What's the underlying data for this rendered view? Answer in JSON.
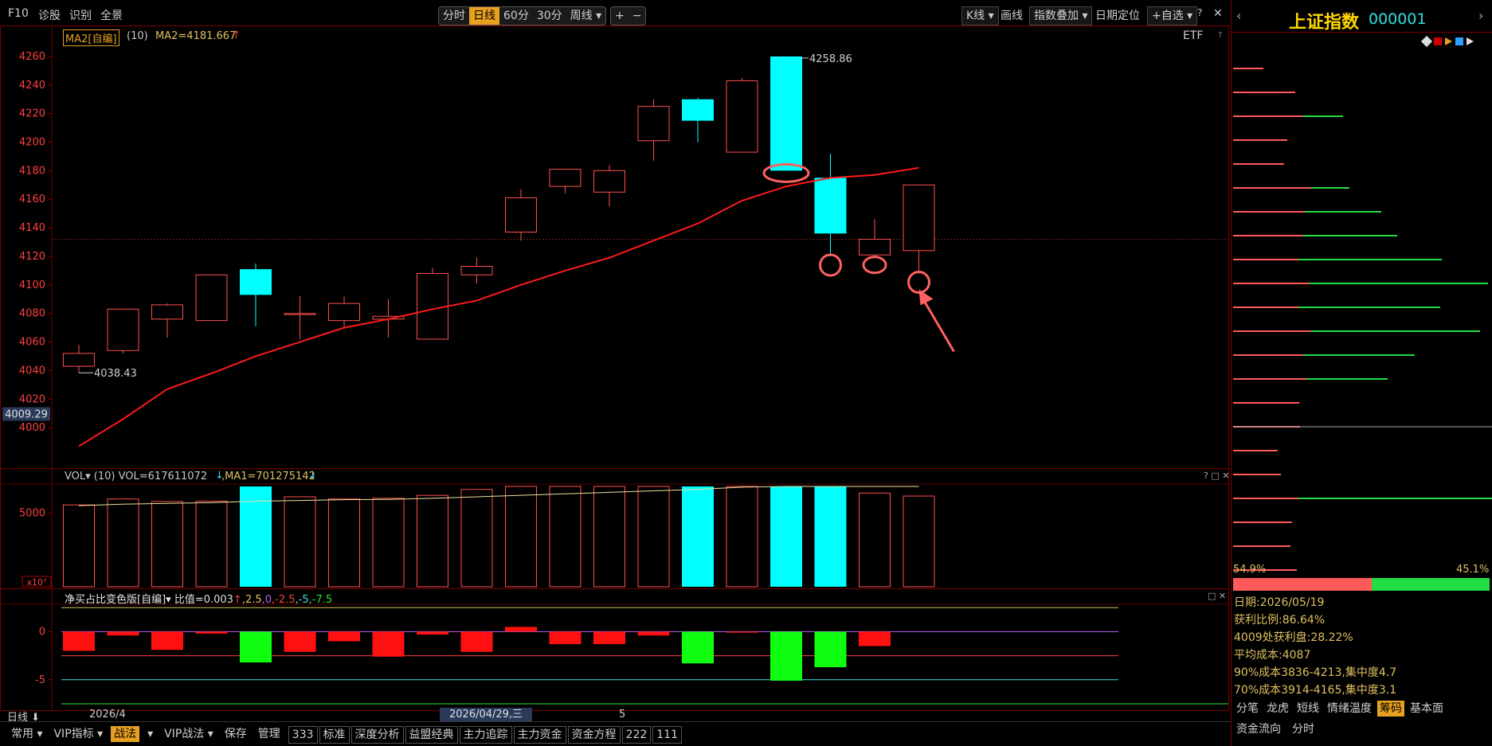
{
  "topbar": {
    "left_items": [
      "F10",
      "诊股",
      "识别",
      "全景"
    ],
    "period_tabs": [
      "分时",
      "日线",
      "60分",
      "30分",
      "周线 ▾"
    ],
    "active_period": "日线",
    "zoom_buttons": [
      "+",
      "−"
    ],
    "right_items": [
      "K线 ▾",
      "画线",
      "指数叠加 ▾",
      "日期定位",
      "+自选 ▾",
      "?",
      "✕"
    ]
  },
  "ma_header": {
    "selector": "MA2[自编]",
    "param": "(10)",
    "value_text": "MA2=4181.667",
    "arrow": "↑"
  },
  "etf_label": "ETF",
  "help_mark": "?",
  "price_axis": {
    "ticks": [
      "4260",
      "4240",
      "4220",
      "4200",
      "4180",
      "4160",
      "4140",
      "4120",
      "4100",
      "4080",
      "4060",
      "4040",
      "4020",
      "4000"
    ],
    "current_price_tag": "4009.29"
  },
  "annotations": {
    "high_label": "4258.86",
    "low_label": "4038.43"
  },
  "vol_header": {
    "text_pre": "VOL▾ (10) VOL=617611072",
    "arrow1": "↓",
    "text_mid": ",MA1=701275142",
    "arrow2": "↓",
    "axis_tick": "5000",
    "unit": "x10⁷",
    "controls": "? □ ✕"
  },
  "ind_header": {
    "name": "净买占比变色版[自编]▾",
    "value": "比值=0.003",
    "arrow": "↑",
    "levels": [
      {
        "text": ",2.5",
        "color": "#e0c060"
      },
      {
        "text": ",0",
        "color": "#c060ff"
      },
      {
        "text": ",-2.5",
        "color": "#ff4040"
      },
      {
        "text": ",-5",
        "color": "#40e0e0"
      },
      {
        "text": ",-7.5",
        "color": "#30e030"
      }
    ],
    "axis_ticks": [
      "0",
      "-5"
    ],
    "controls": "□ ✕"
  },
  "datebar": {
    "label": "日线 ⬇",
    "start": "2026/4",
    "cursor_date": "2026/04/29,三",
    "tick5": "5"
  },
  "bottombar": {
    "items": [
      {
        "label": "常用 ▾",
        "sel": false,
        "box": false
      },
      {
        "label": "VIP指标 ▾",
        "sel": false,
        "box": false
      },
      {
        "label": "战法",
        "sel": true,
        "box": false
      },
      {
        "label": "▾",
        "sel": false,
        "box": false
      },
      {
        "label": "VIP战法 ▾",
        "sel": false,
        "box": false
      },
      {
        "label": "保存",
        "sel": false,
        "box": false
      },
      {
        "label": "管理",
        "sel": false,
        "box": false
      },
      {
        "label": "333",
        "sel": false,
        "box": true
      },
      {
        "label": "标准",
        "sel": false,
        "box": true
      },
      {
        "label": "深度分析",
        "sel": false,
        "box": true
      },
      {
        "label": "益盟经典",
        "sel": false,
        "box": true
      },
      {
        "label": "主力追踪",
        "sel": false,
        "box": true
      },
      {
        "label": "主力资金",
        "sel": false,
        "box": true
      },
      {
        "label": "资金方程",
        "sel": false,
        "box": true
      },
      {
        "label": "222",
        "sel": false,
        "box": true
      },
      {
        "label": "111",
        "sel": false,
        "box": true
      }
    ]
  },
  "rpanel": {
    "title": "上证指数",
    "code": "000001",
    "pct_left": "54.9%",
    "pct_right": "45.1%",
    "info": [
      "日期:2026/05/19",
      "获利比例:86.64%",
      "4009处获利盘:28.22%",
      "平均成本:4087",
      "90%成本3836-4213,集中度4.7",
      "70%成本3914-4165,集中度3.1"
    ],
    "tabs": [
      "分笔",
      "龙虎",
      "短线",
      "情绪温度",
      "筹码",
      "基本面"
    ],
    "active_tab": "筹码",
    "tabs2": [
      "资金流向",
      "分时"
    ]
  },
  "colors": {
    "up": "#ff5050",
    "down": "#00ffff",
    "ma": "#ff1a1a",
    "accent": "#e8a020",
    "axis_red": "#ff4040"
  },
  "chart_data": {
    "type": "candlestick",
    "ylim": [
      3980,
      4270
    ],
    "candles": [
      {
        "o": 4043,
        "c": 4052,
        "h": 4058,
        "l": 4038.43
      },
      {
        "o": 4054,
        "c": 4083,
        "h": 4083,
        "l": 4052
      },
      {
        "o": 4076,
        "c": 4086,
        "h": 4087,
        "l": 4063
      },
      {
        "o": 4075,
        "c": 4107,
        "h": 4107,
        "l": 4075
      },
      {
        "o": 4111,
        "c": 4093,
        "h": 4115,
        "l": 4071
      },
      {
        "o": 4080,
        "c": 4080,
        "h": 4092,
        "l": 4062
      },
      {
        "o": 4075,
        "c": 4087,
        "h": 4092,
        "l": 4070
      },
      {
        "o": 4076,
        "c": 4078,
        "h": 4090,
        "l": 4063
      },
      {
        "o": 4062,
        "c": 4108,
        "h": 4112,
        "l": 4062
      },
      {
        "o": 4107,
        "c": 4113,
        "h": 4119,
        "l": 4101
      },
      {
        "o": 4137,
        "c": 4161,
        "h": 4167,
        "l": 4131
      },
      {
        "o": 4169,
        "c": 4181,
        "h": 4181,
        "l": 4164
      },
      {
        "o": 4165,
        "c": 4180,
        "h": 4184,
        "l": 4155
      },
      {
        "o": 4201,
        "c": 4225,
        "h": 4230,
        "l": 4187
      },
      {
        "o": 4230,
        "c": 4215,
        "h": 4231,
        "l": 4200
      },
      {
        "o": 4193,
        "c": 4243,
        "h": 4245,
        "l": 4193
      },
      {
        "o": 4260,
        "c": 4180,
        "h": 4258.86,
        "l": 4180
      },
      {
        "o": 4175,
        "c": 4136,
        "h": 4192,
        "l": 4120
      },
      {
        "o": 4121,
        "c": 4132,
        "h": 4146,
        "l": 4119
      },
      {
        "o": 4124,
        "c": 4170,
        "h": 4170,
        "l": 4108
      }
    ],
    "ma2": [
      3987,
      4006,
      4027,
      4038,
      4050,
      4060,
      4070,
      4076,
      4083,
      4089,
      4100,
      4110,
      4119,
      4131,
      4143,
      4159,
      4169,
      4175,
      4177,
      4182
    ],
    "volume": {
      "ylim": [
        0,
        6800
      ],
      "values": [
        5550,
        5950,
        5780,
        5800,
        6850,
        6100,
        5950,
        6000,
        6200,
        6600,
        7050,
        6900,
        6950,
        7700,
        7250,
        7100,
        7700,
        7400,
        6350,
        6150
      ],
      "ma": [
        5500,
        5600,
        5650,
        5700,
        5800,
        5850,
        5900,
        5920,
        6000,
        6100,
        6200,
        6300,
        6400,
        6500,
        6600,
        6750,
        6900,
        7050,
        7100,
        7050
      ]
    },
    "indicator": {
      "ylim": [
        -8,
        2.6
      ],
      "levels": [
        2.5,
        0,
        -2.5,
        -5,
        -7.5
      ],
      "values": [
        -2.0,
        -0.4,
        -1.9,
        -0.2,
        -3.2,
        -2.1,
        -1.0,
        -2.6,
        -0.3,
        -2.1,
        0.5,
        -1.3,
        -1.3,
        -0.4,
        -3.3,
        -0.1,
        -5.1,
        -3.7,
        -1.5,
        0
      ]
    }
  }
}
